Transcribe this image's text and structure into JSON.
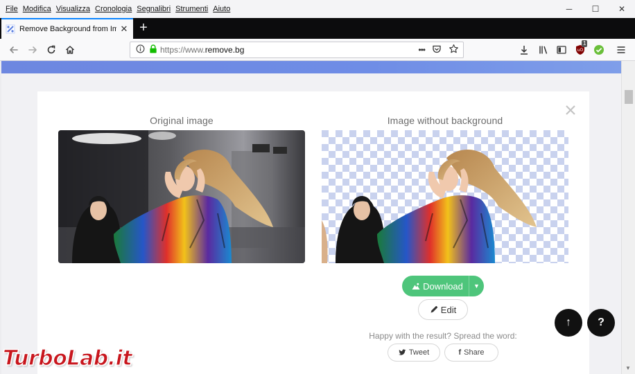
{
  "menubar": {
    "items": [
      "File",
      "Modifica",
      "Visualizza",
      "Cronologia",
      "Segnalibri",
      "Strumenti",
      "Aiuto"
    ]
  },
  "window_controls": {
    "minimize": "─",
    "maximize": "☐",
    "close": "✕"
  },
  "tab": {
    "title": "Remove Background from Ima",
    "close": "✕",
    "new_tab": "+"
  },
  "navbar": {
    "url_scheme": "https://www.",
    "url_host": "remove.bg",
    "page_actions": "•••",
    "badge_count": "1"
  },
  "modal": {
    "original_title": "Original image",
    "result_title": "Image without background",
    "close": "✕"
  },
  "actions": {
    "download_label": "Download",
    "edit_label": "Edit",
    "share_prompt": "Happy with the result? Spread the word:",
    "tweet_label": "Tweet",
    "share_label": "Share"
  },
  "fab": {
    "up": "↑",
    "help": "?"
  },
  "watermark": {
    "text": "TurboLab.it"
  },
  "colors": {
    "accent_green": "#4ec57b",
    "header_blue": "#6d87e0",
    "firefox_blue": "#0a84ff",
    "watermark_red": "#c8161d"
  },
  "icons": {
    "back": "arrow-left-icon",
    "forward": "arrow-right-icon",
    "reload": "reload-icon",
    "home": "home-icon",
    "info": "info-icon",
    "lock": "lock-icon",
    "pocket": "pocket-icon",
    "bookmark": "star-icon",
    "downloads": "download-arrow-icon",
    "library": "library-icon",
    "sidebar": "sidebar-icon",
    "ublock": "ublock-shield-icon",
    "check": "check-circle-icon",
    "menu": "hamburger-menu-icon"
  }
}
